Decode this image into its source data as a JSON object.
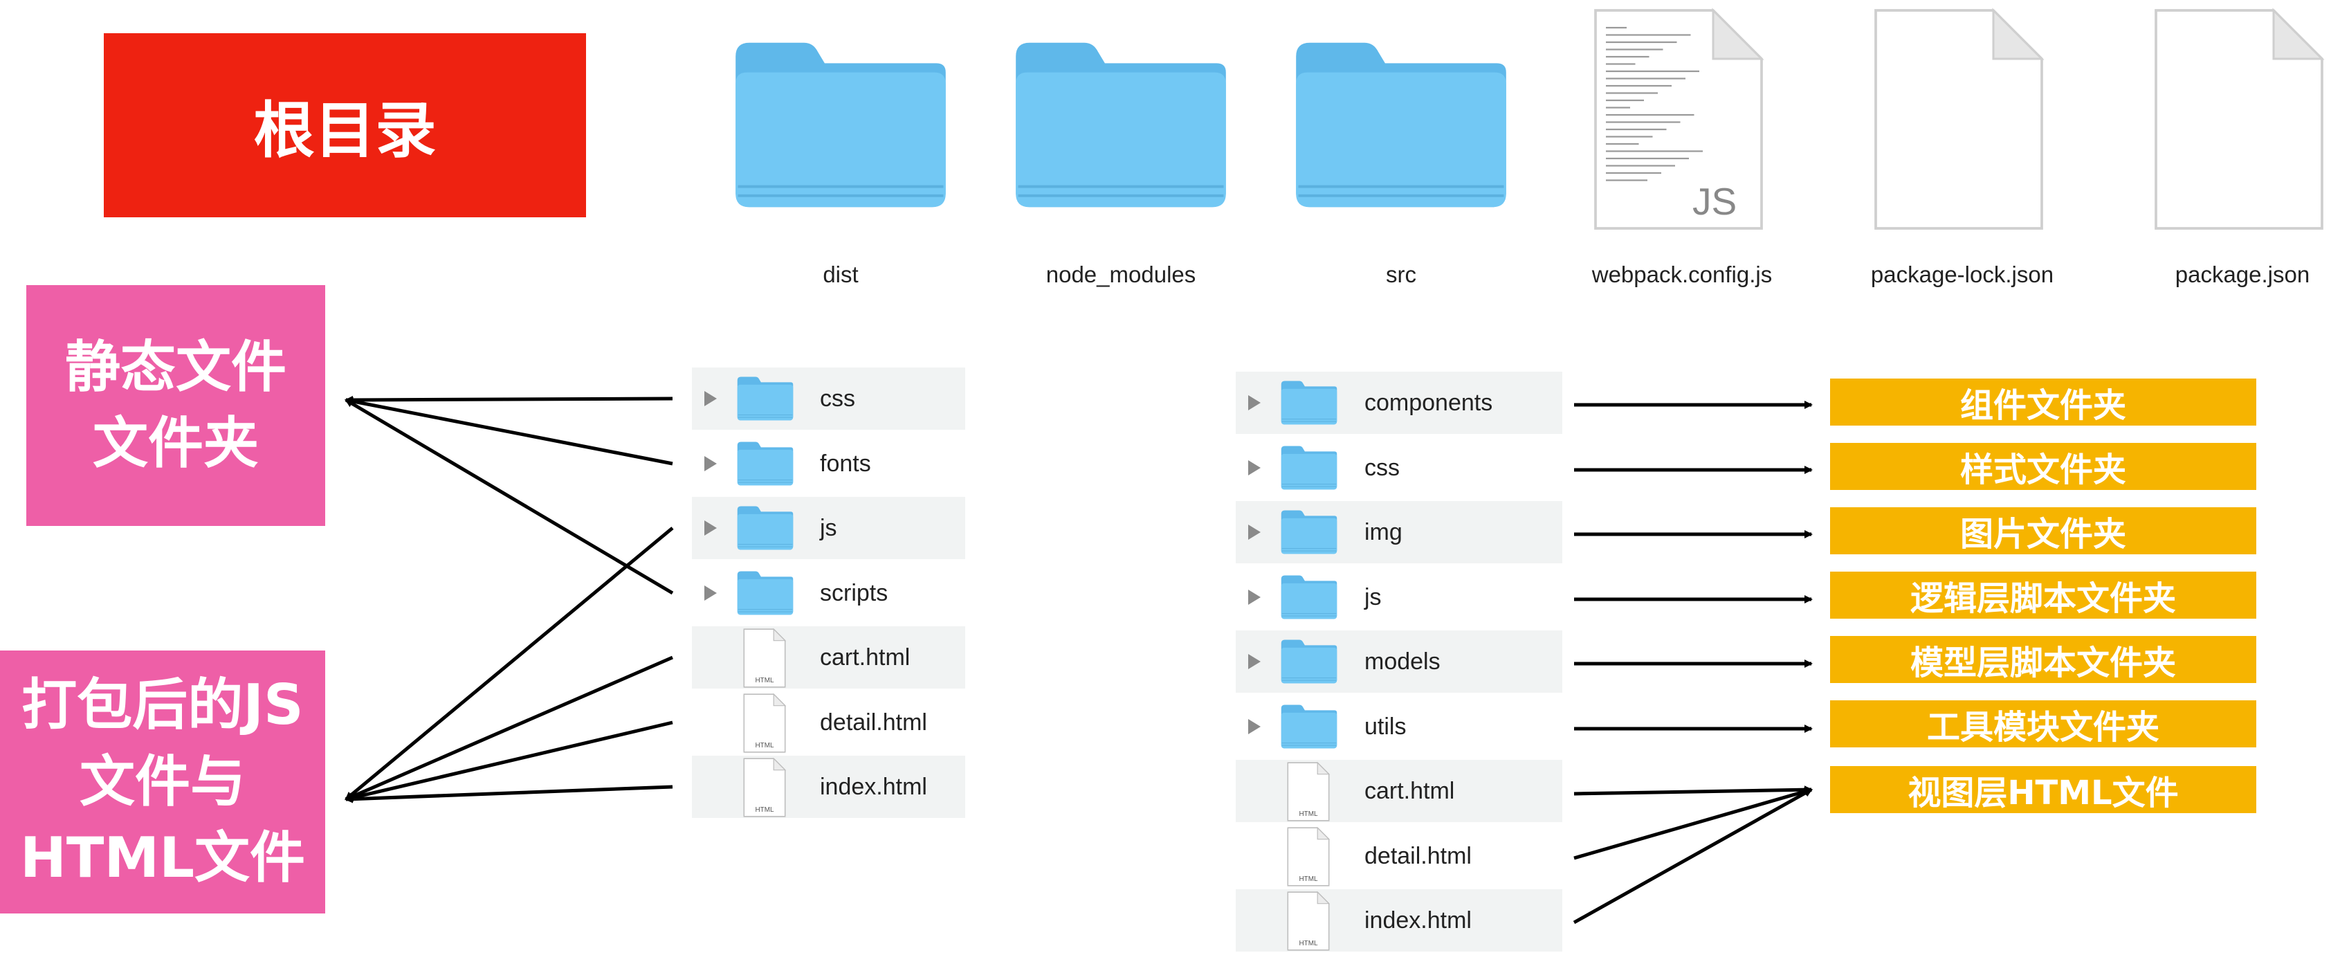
{
  "root_label": "根目录",
  "static_label": [
    "静态文件",
    "文件夹"
  ],
  "bundle_label": [
    "打包后的JS",
    "文件与",
    "HTML文件"
  ],
  "top_items": [
    {
      "label": "dist",
      "icon": "folder-icon"
    },
    {
      "label": "node_modules",
      "icon": "folder-icon"
    },
    {
      "label": "src",
      "icon": "folder-icon"
    },
    {
      "label": "webpack.config.js",
      "icon": "js-file-icon",
      "badge": "JS"
    },
    {
      "label": "package-lock.json",
      "icon": "file-icon"
    },
    {
      "label": "package.json",
      "icon": "file-icon"
    }
  ],
  "dist_items": [
    {
      "label": "css",
      "type": "folder"
    },
    {
      "label": "fonts",
      "type": "folder"
    },
    {
      "label": "js",
      "type": "folder"
    },
    {
      "label": "scripts",
      "type": "folder"
    },
    {
      "label": "cart.html",
      "type": "html"
    },
    {
      "label": "detail.html",
      "type": "html"
    },
    {
      "label": "index.html",
      "type": "html"
    }
  ],
  "src_items": [
    {
      "label": "components",
      "type": "folder"
    },
    {
      "label": "css",
      "type": "folder"
    },
    {
      "label": "img",
      "type": "folder"
    },
    {
      "label": "js",
      "type": "folder"
    },
    {
      "label": "models",
      "type": "folder"
    },
    {
      "label": "utils",
      "type": "folder"
    },
    {
      "label": "cart.html",
      "type": "html"
    },
    {
      "label": "detail.html",
      "type": "html"
    },
    {
      "label": "index.html",
      "type": "html"
    }
  ],
  "src_descriptions": [
    "组件文件夹",
    "样式文件夹",
    "图片文件夹",
    "逻辑层脚本文件夹",
    "模型层脚本文件夹",
    "工具模块文件夹",
    "视图层HTML文件"
  ],
  "html_badge": "HTML",
  "colors": {
    "root": "#ee2211",
    "pink": "#ee5fa7",
    "yellow": "#f6b400",
    "folder": "#6ec6f2"
  }
}
